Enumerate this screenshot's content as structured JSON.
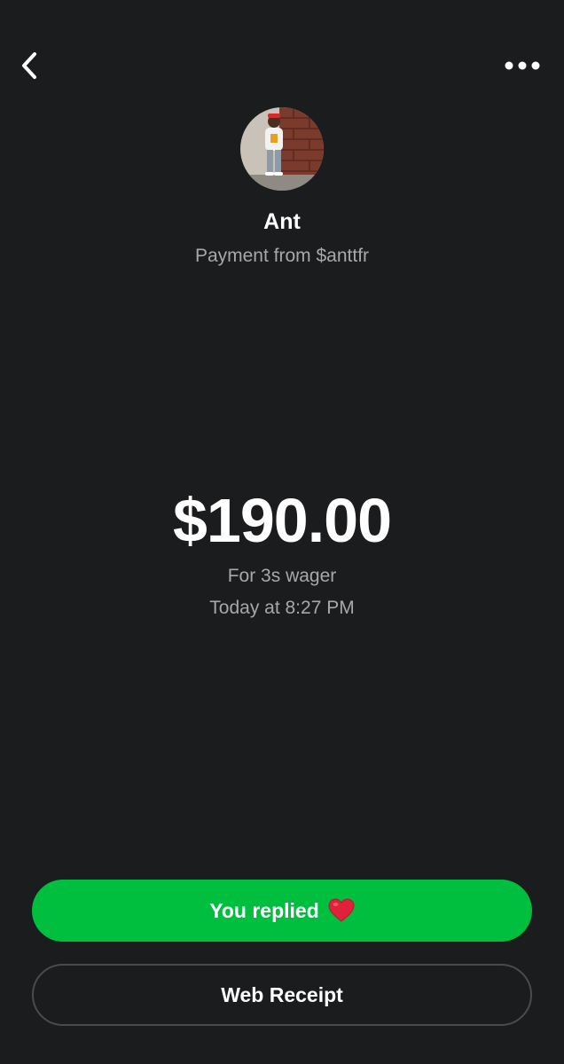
{
  "header": {
    "back_icon": "chevron-left-icon",
    "more_icon": "more-horizontal-icon"
  },
  "profile": {
    "avatar_icon": "profile-photo",
    "name": "Ant",
    "subtitle": "Payment from $anttfr"
  },
  "payment": {
    "amount": "$190.00",
    "note": "For 3s wager",
    "timestamp": "Today at 8:27 PM"
  },
  "actions": {
    "reply_label": "You replied",
    "reply_icon": "heart-icon",
    "receipt_label": "Web Receipt"
  },
  "colors": {
    "background": "#1b1c1e",
    "accent_green": "#00bf3f",
    "secondary_text": "#a7a8ab",
    "heart_red": "#e0213a"
  }
}
